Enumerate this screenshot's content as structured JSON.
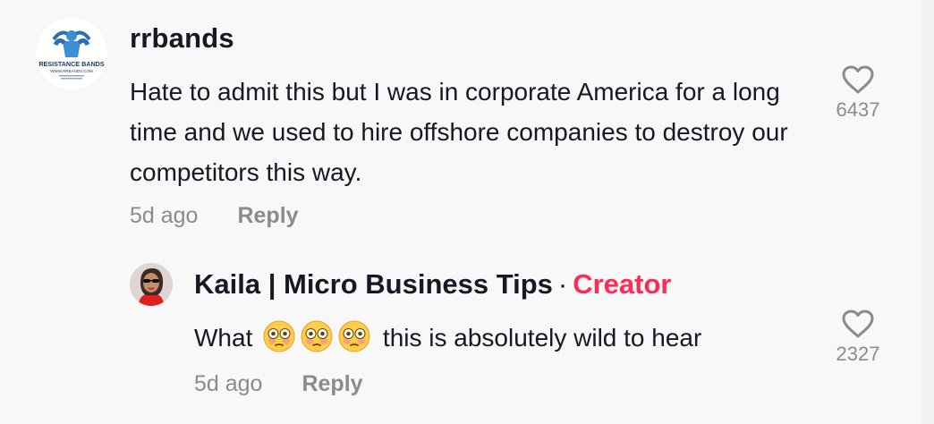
{
  "comment": {
    "username": "rrbands",
    "avatar_text": "RESISTANCE BANDS",
    "avatar_subtext": "WWW.RRBANDS.COM",
    "text": "Hate to admit this but I was in corporate America for a long time and we used to hire offshore companies to destroy our competitors this way.",
    "time": "5d ago",
    "reply_label": "Reply",
    "like_count": "6437"
  },
  "reply": {
    "username": "Kaila | Micro Business Tips",
    "separator": "·",
    "badge": "Creator",
    "text_before": "What",
    "emojis": [
      "flushed-face",
      "flushed-face",
      "flushed-face"
    ],
    "text_after": "this is absolutely wild to hear",
    "time": "5d ago",
    "reply_label": "Reply",
    "like_count": "2327"
  },
  "colors": {
    "background": "#f8f8f8",
    "text": "#161823",
    "secondary": "#8a8b91",
    "creator_badge": "#fe2c55"
  }
}
